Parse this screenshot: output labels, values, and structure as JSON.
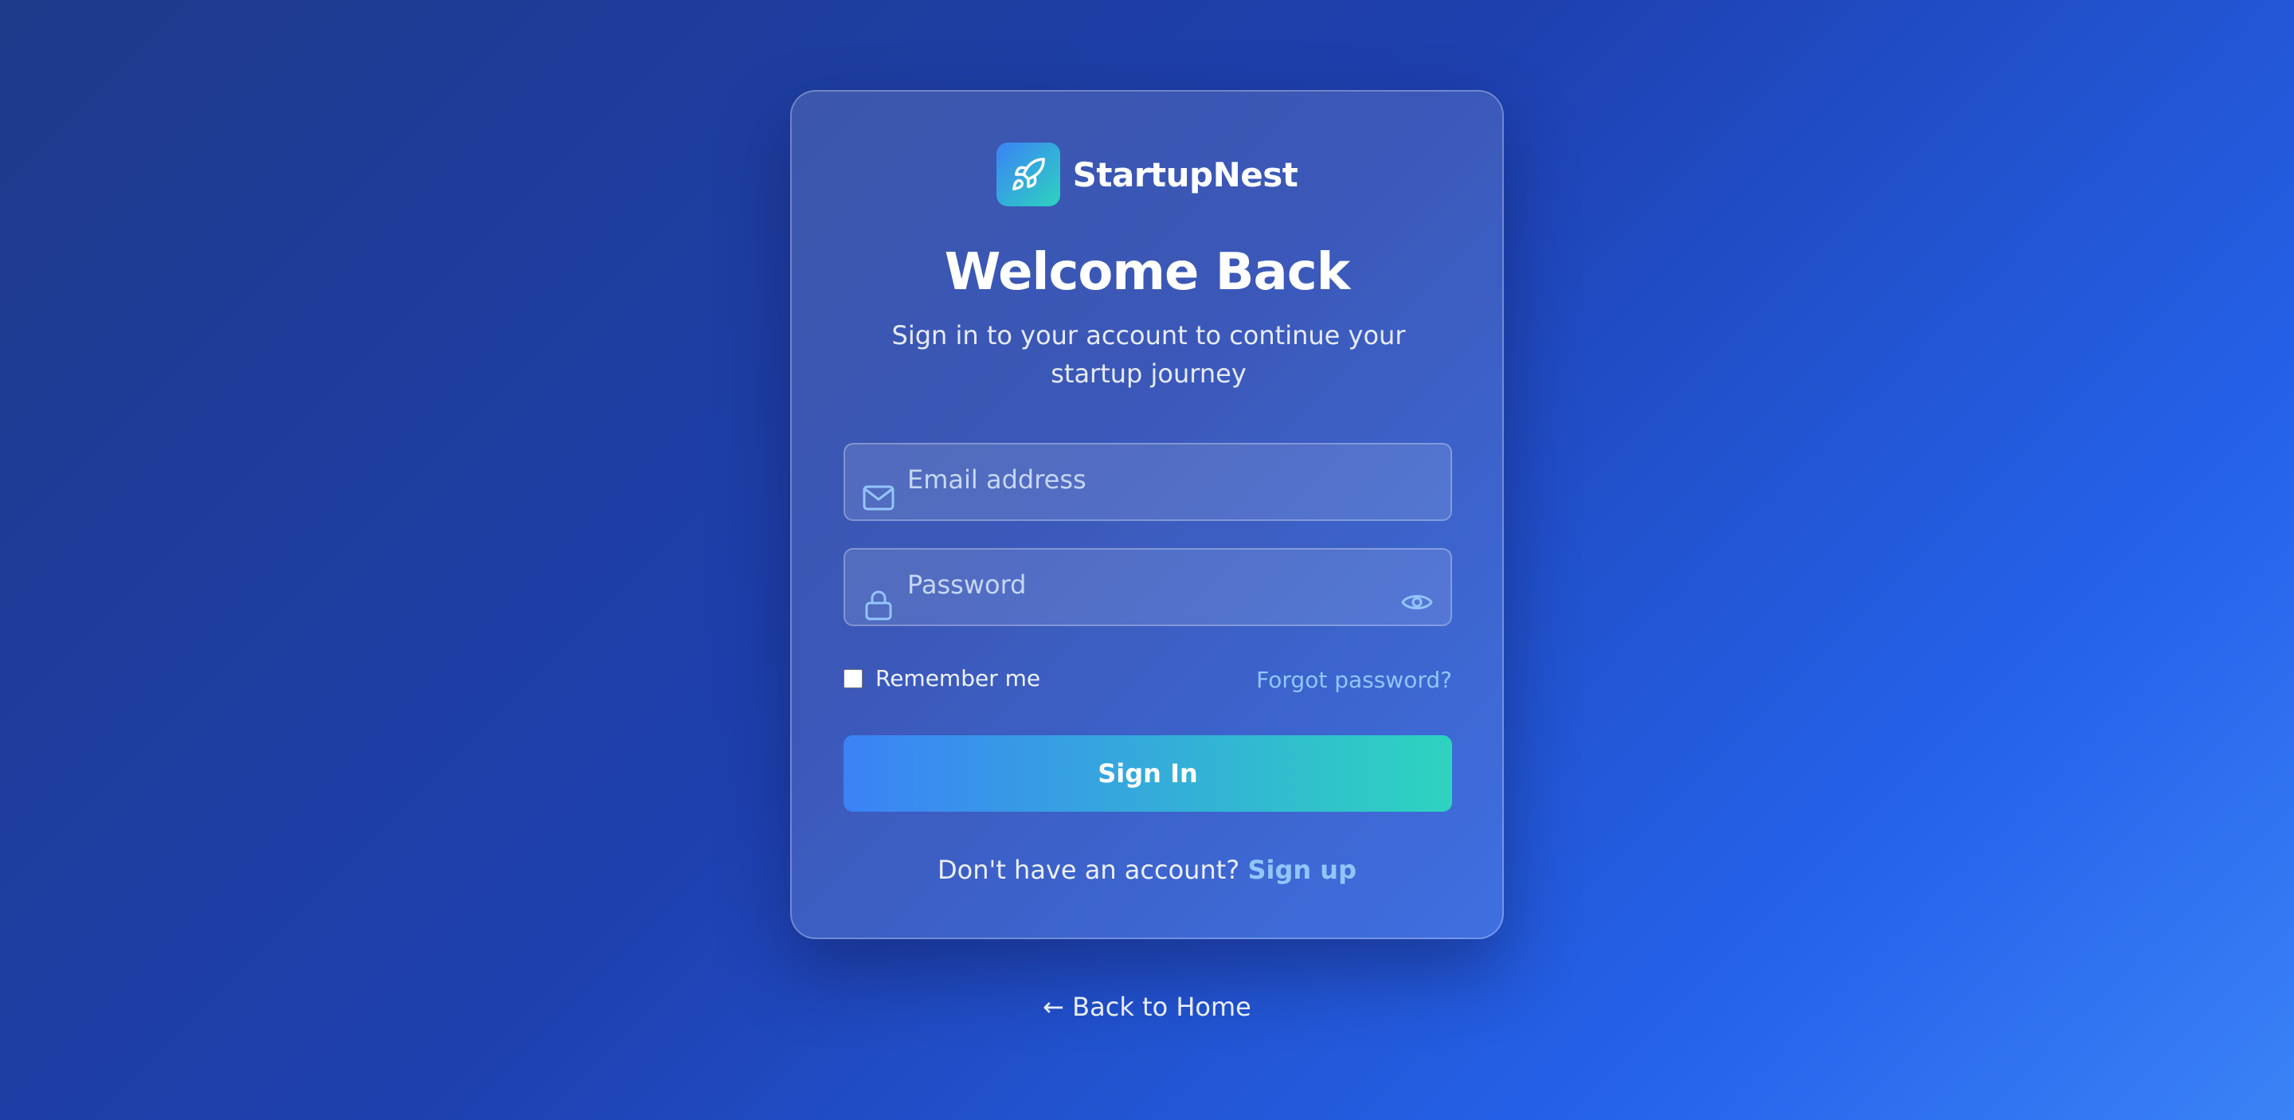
{
  "brand": {
    "name": "StartupNest",
    "logo_icon": "rocket-icon"
  },
  "heading": {
    "title": "Welcome Back",
    "subtitle": "Sign in to your account to continue your startup journey"
  },
  "form": {
    "email": {
      "placeholder": "Email address",
      "value": "",
      "icon": "mail-icon"
    },
    "password": {
      "placeholder": "Password",
      "value": "",
      "icon": "lock-icon",
      "toggle_icon": "eye-icon"
    },
    "remember_label": "Remember me",
    "remember_checked": false,
    "forgot_label": "Forgot password?",
    "submit_label": "Sign In"
  },
  "signup": {
    "prompt": "Don't have an account?",
    "link_label": "Sign up"
  },
  "back_link": "← Back to Home",
  "colors": {
    "accent_start": "#3b82f6",
    "accent_end": "#2dd4bf",
    "link": "#93c5fd",
    "background": "#1e40af"
  }
}
